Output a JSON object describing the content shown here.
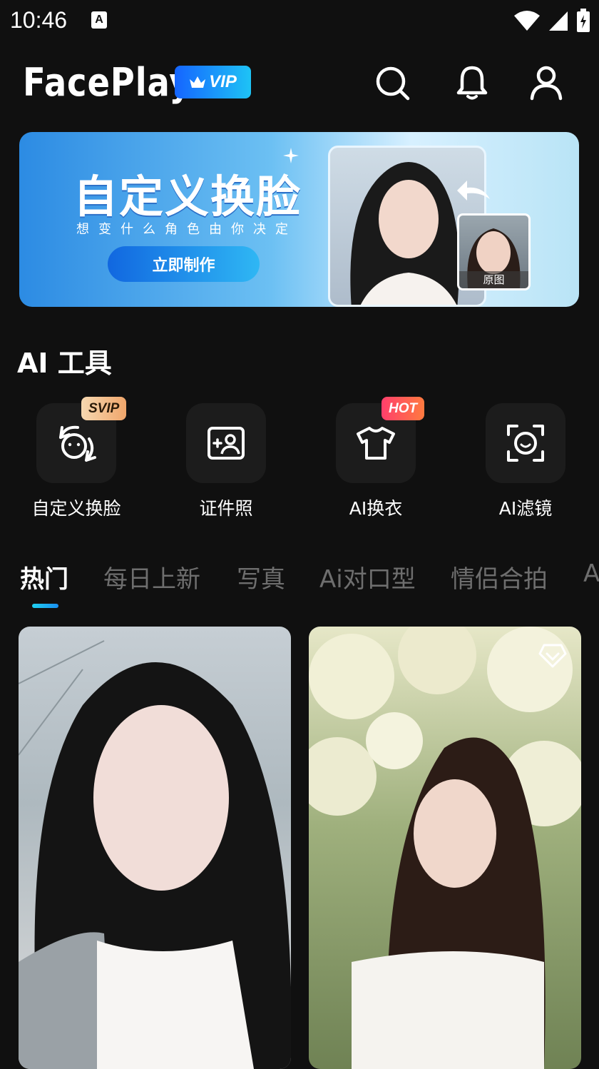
{
  "status_bar": {
    "time": "10:46",
    "a_icon": "A"
  },
  "header": {
    "logo": "FacePlay",
    "vip_label": "VIP"
  },
  "banner": {
    "title": "自定义换脸",
    "subtitle": "想变什么角色由你决定",
    "button": "立即制作",
    "thumb_label": "原图"
  },
  "ai_tools": {
    "title": "AI 工具",
    "items": [
      {
        "label": "自定义换脸",
        "badge": "SVIP",
        "icon": "face-swap-icon"
      },
      {
        "label": "证件照",
        "badge": "",
        "icon": "id-photo-icon"
      },
      {
        "label": "AI换衣",
        "badge": "HOT",
        "icon": "tshirt-icon"
      },
      {
        "label": "AI滤镜",
        "badge": "",
        "icon": "face-scan-icon"
      }
    ]
  },
  "tabs": [
    "热门",
    "每日上新",
    "写真",
    "Ai对口型",
    "情侣合拍",
    "A"
  ],
  "colors": {
    "background": "#101010",
    "accent": "#1fb4f5",
    "vip": "#1565ff",
    "hot": "#ff3f6c"
  }
}
